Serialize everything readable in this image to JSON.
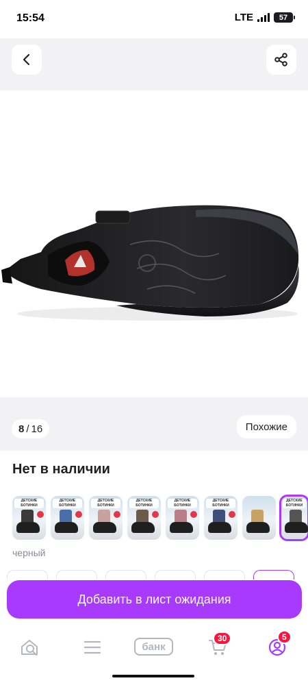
{
  "status_bar": {
    "time": "15:54",
    "network": "LTE",
    "battery": "57"
  },
  "top_bar": {
    "back_icon": "chevron-left-icon",
    "share_icon": "share-icon"
  },
  "gallery": {
    "current_page": "8",
    "separator": "/",
    "total_pages": "16",
    "similar_label": "Похожие"
  },
  "product": {
    "stock_status": "Нет в наличии",
    "selected_color": "черный",
    "variants": [
      {
        "tag": "ДЕТСКИЕ БОТИНКИ",
        "legs": "#3a3a3a",
        "selected": false
      },
      {
        "tag": "ДЕТСКИЕ БОТИНКИ",
        "legs": "#4a6ea8",
        "selected": false
      },
      {
        "tag": "ДЕТСКИЕ БОТИНКИ",
        "legs": "#c9a0a0",
        "selected": false
      },
      {
        "tag": "ДЕТСКИЕ БОТИНКИ",
        "legs": "#6c5a48",
        "selected": false
      },
      {
        "tag": "ДЕТСКИЕ БОТИНКИ",
        "legs": "#b87f88",
        "selected": false
      },
      {
        "tag": "ДЕТСКИЕ БОТИНКИ",
        "legs": "#3e4f7a",
        "selected": false
      },
      {
        "tag": "",
        "legs": "#c8a165",
        "selected": false
      },
      {
        "tag": "ДЕТСКИЕ БОТИНКИ",
        "legs": "#555555",
        "selected": true
      }
    ]
  },
  "cta": {
    "label": "Добавить в лист ожидания"
  },
  "tab_bar": {
    "bank_label": "банк",
    "cart_count": "30",
    "profile_count": "5"
  },
  "colors": {
    "accent": "#a73afd",
    "badge": "#f5183e",
    "background_gray": "#f2f2f4"
  }
}
